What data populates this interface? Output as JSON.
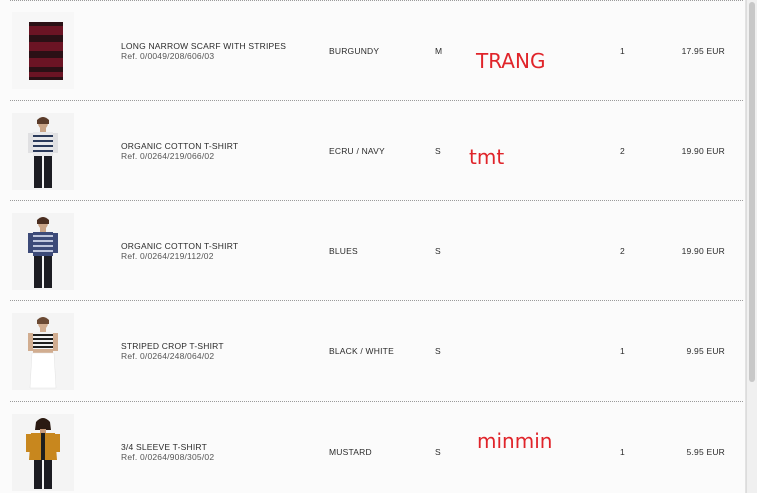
{
  "cart": {
    "items": [
      {
        "name": "LONG NARROW SCARF WITH STRIPES",
        "ref": "Ref. 0/0049/208/606/03",
        "color": "BURGUNDY",
        "size": "M",
        "quantity": "1",
        "price": "17.95 EUR",
        "image": "scarf-thumbnail",
        "note": "TRANG"
      },
      {
        "name": "ORGANIC COTTON T-SHIRT",
        "ref": "Ref. 0/0264/219/066/02",
        "color": "ECRU / NAVY",
        "size": "S",
        "quantity": "2",
        "price": "19.90 EUR",
        "image": "striped-tshirt-model-thumbnail",
        "note": "tmt"
      },
      {
        "name": "ORGANIC COTTON T-SHIRT",
        "ref": "Ref. 0/0264/219/112/02",
        "color": "BLUES",
        "size": "S",
        "quantity": "2",
        "price": "19.90 EUR",
        "image": "striped-tshirt-model-thumbnail",
        "note": ""
      },
      {
        "name": "STRIPED CROP T-SHIRT",
        "ref": "Ref. 0/0264/248/064/02",
        "color": "BLACK / WHITE",
        "size": "S",
        "quantity": "1",
        "price": "9.95 EUR",
        "image": "crop-tshirt-model-thumbnail",
        "note": ""
      },
      {
        "name": "3/4 SLEEVE T-SHIRT",
        "ref": "Ref. 0/0264/908/305/02",
        "color": "MUSTARD",
        "size": "S",
        "quantity": "1",
        "price": "5.95 EUR",
        "image": "mustard-tshirt-model-thumbnail",
        "note": "minmin"
      }
    ]
  },
  "colors": {
    "note_red": "#e0242a",
    "scarf_burgundy": "#6b1424",
    "mustard": "#c8871e",
    "divider": "#9a9a9a"
  }
}
